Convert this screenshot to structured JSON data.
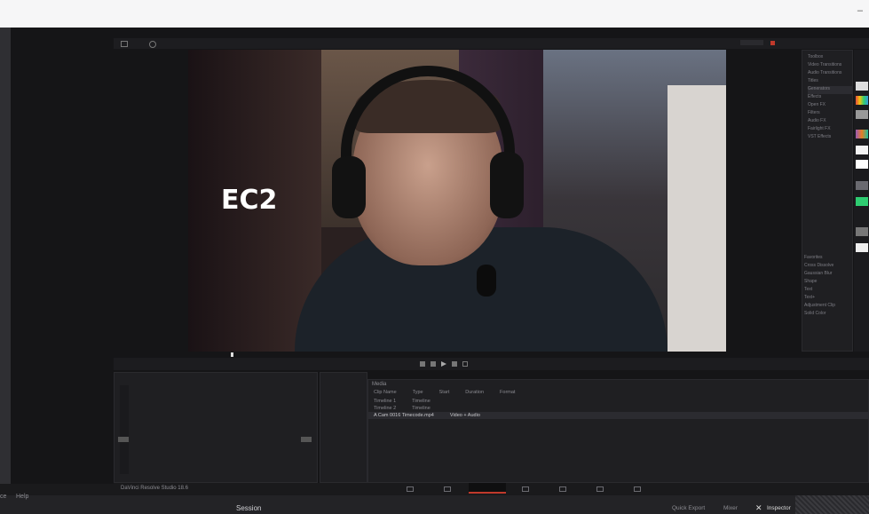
{
  "window": {
    "minimize_glyph": "–"
  },
  "app": {
    "project_name": "Session",
    "brand": "DaVinci Resolve Studio 18.6"
  },
  "viewer": {
    "overlay_text": "EC2"
  },
  "bottom": {
    "left_items": [
      "ce",
      "Help"
    ],
    "center_label": "Session",
    "right_items": [
      "Quick Export",
      "Mixer",
      "Inspector"
    ]
  },
  "media_pool": {
    "title": "Media",
    "columns": [
      "Clip Name",
      "Type",
      "Start",
      "Duration",
      "Format"
    ],
    "rows": [
      {
        "name": "Timeline 1",
        "type": "Timeline",
        "selected": false
      },
      {
        "name": "Timeline 2",
        "type": "Timeline",
        "selected": false
      },
      {
        "name": "A Cam 0016 Timecode.mp4",
        "type": "Video + Audio",
        "selected": true
      }
    ]
  },
  "effects": {
    "items": [
      "Toolbox",
      "Video Transitions",
      "Audio Transitions",
      "Titles",
      "Generators",
      "Effects",
      "Open FX",
      "Filters",
      "Audio FX",
      "Fairlight FX",
      "VST Effects"
    ],
    "lower_items": [
      "Favorites",
      "Cross Dissolve",
      "Gaussian Blur",
      "Shape",
      "Text",
      "Text+",
      "Adjustment Clip",
      "Solid Color"
    ]
  },
  "colors": {
    "accent": "#c0392b",
    "panel": "#1f1f22",
    "background": "#151517"
  }
}
